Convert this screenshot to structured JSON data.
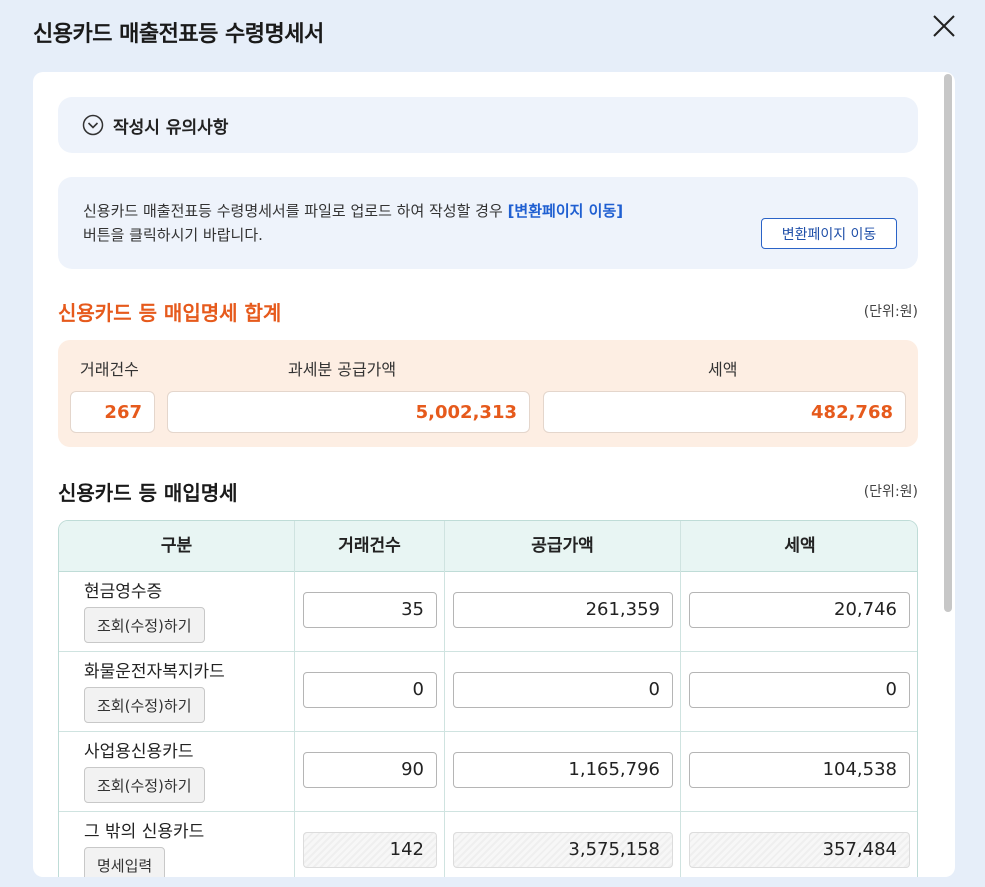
{
  "dialog": {
    "title": "신용카드 매출전표등 수령명세서",
    "close_icon": "close-icon"
  },
  "notice": {
    "label": "작성시 유의사항",
    "icon": "chevron-down-circle-icon"
  },
  "info": {
    "text_before": "신용카드 매출전표등 수령명세서를 파일로 업로드 하여 작성할 경우 ",
    "highlight": "[변환페이지 이동]",
    "text_line2": "버튼을 클릭하시기 바랍니다.",
    "button_label": "변환페이지 이동"
  },
  "summary": {
    "title": "신용카드 등 매입명세 합계",
    "unit": "(단위:원)",
    "headers": {
      "count": "거래건수",
      "supply": "과세분 공급가액",
      "tax": "세액"
    },
    "values": {
      "count": "267",
      "supply": "5,002,313",
      "tax": "482,768"
    }
  },
  "detail": {
    "title": "신용카드 등 매입명세",
    "unit": "(단위:원)",
    "columns": [
      "구분",
      "거래건수",
      "공급가액",
      "세액"
    ],
    "rows": [
      {
        "name": "현금영수증",
        "button": "조회(수정)하기",
        "count": "35",
        "supply": "261,359",
        "tax": "20,746"
      },
      {
        "name": "화물운전자복지카드",
        "button": "조회(수정)하기",
        "count": "0",
        "supply": "0",
        "tax": "0"
      },
      {
        "name": "사업용신용카드",
        "button": "조회(수정)하기",
        "count": "90",
        "supply": "1,165,796",
        "tax": "104,538"
      },
      {
        "name": "그 밖의 신용카드",
        "button": "명세입력",
        "count": "142",
        "supply": "3,575,158",
        "tax": "357,484"
      }
    ]
  },
  "colors": {
    "accent_orange": "#e65a1c",
    "link_blue": "#1f5fd1",
    "summary_bg": "#fdeee3",
    "table_header_bg": "#e8f5f3"
  }
}
